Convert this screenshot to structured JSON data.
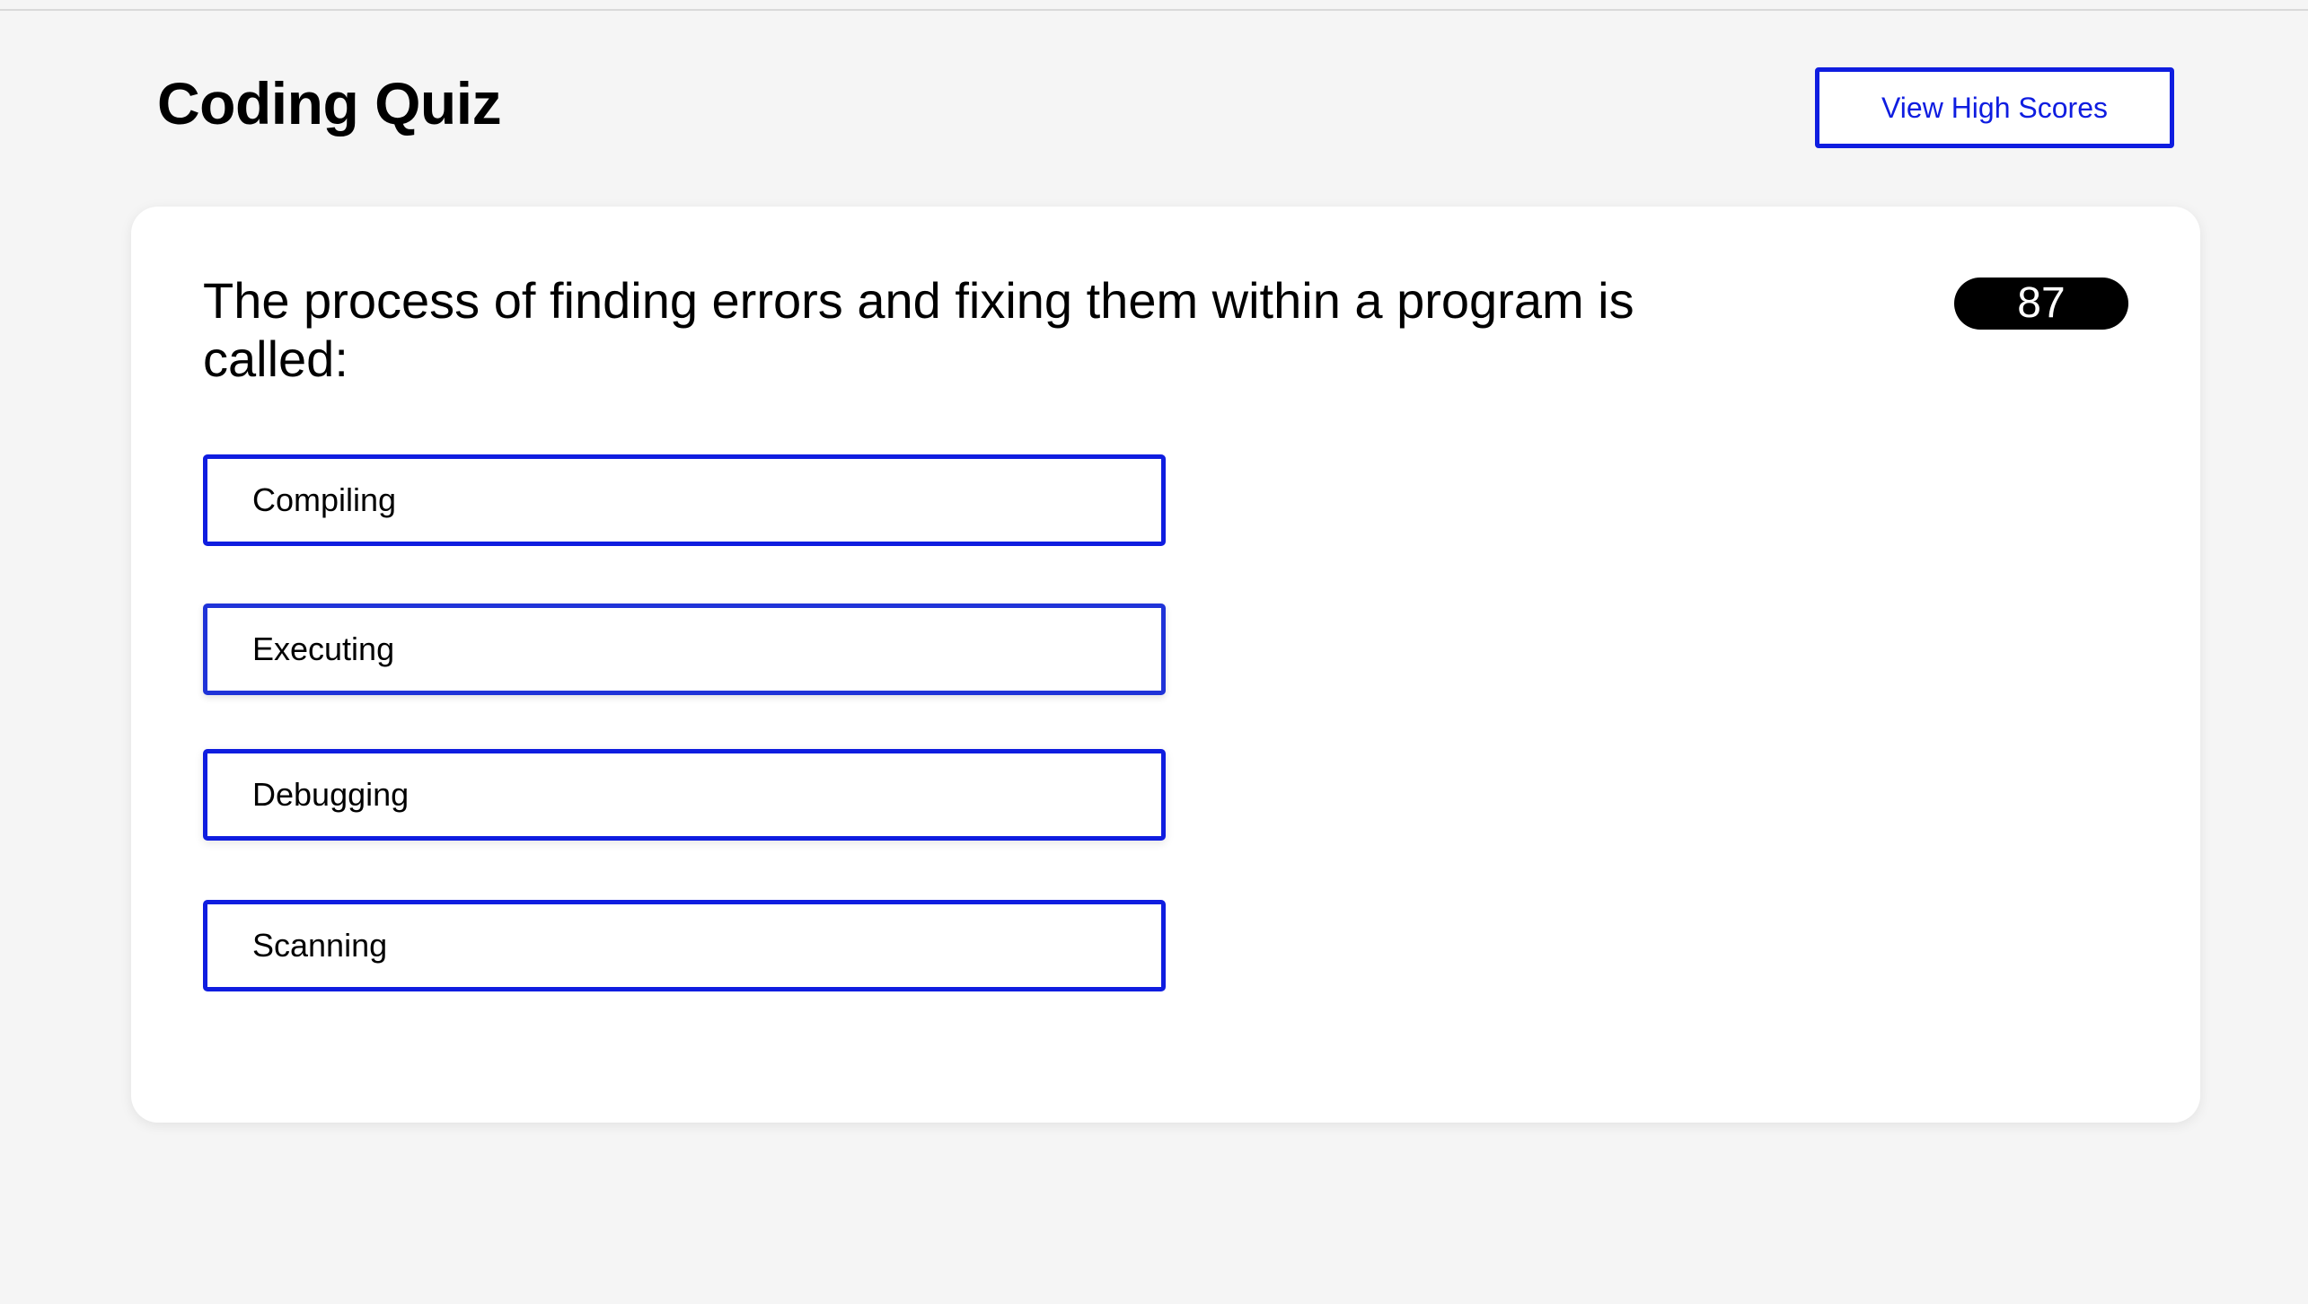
{
  "header": {
    "title": "Coding Quiz",
    "high_scores_label": "View High Scores"
  },
  "quiz": {
    "question": "The process of finding errors and fixing them within a program is called:",
    "timer": "87",
    "answers": [
      {
        "label": "Compiling"
      },
      {
        "label": "Executing"
      },
      {
        "label": "Debugging"
      },
      {
        "label": "Scanning"
      }
    ]
  },
  "colors": {
    "accent": "#0f1de0",
    "page_background": "#f5f5f5",
    "card_background": "#ffffff",
    "timer_background": "#000000"
  }
}
